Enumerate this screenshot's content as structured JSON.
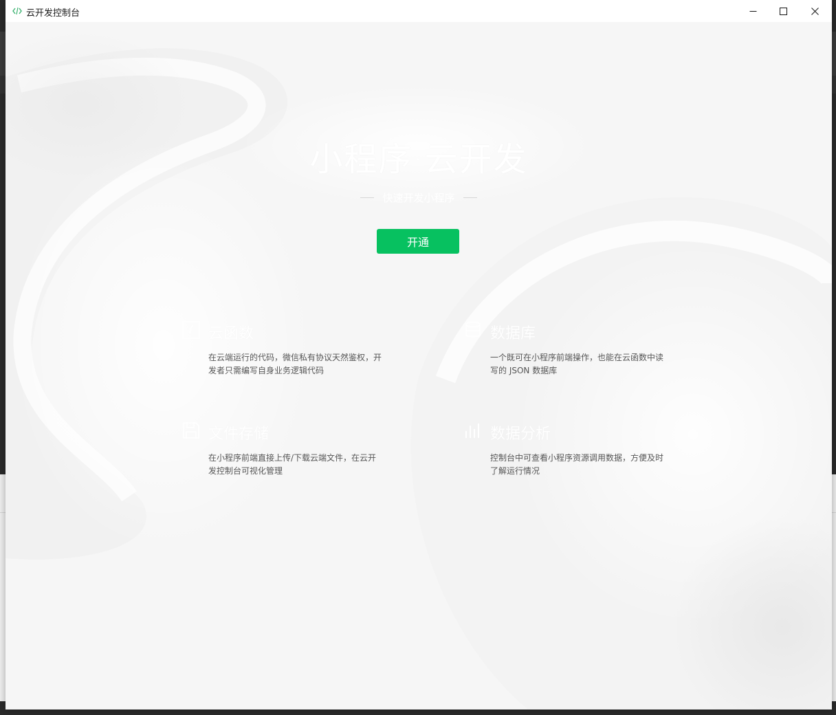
{
  "window": {
    "title": "云开发控制台",
    "controls": {
      "minimize_icon": "minimize-icon",
      "maximize_icon": "maximize-icon",
      "close_icon": "close-icon"
    }
  },
  "hero": {
    "title": "小程序·云开发",
    "subtitle": "快速开发小程序",
    "cta_label": "开通"
  },
  "features": [
    {
      "icon": "function-icon",
      "title": "云函数",
      "description": "在云端运行的代码，微信私有协议天然鉴权，开发者只需编写自身业务逻辑代码"
    },
    {
      "icon": "database-icon",
      "title": "数据库",
      "description": "一个既可在小程序前端操作，也能在云函数中读写的 JSON 数据库"
    },
    {
      "icon": "storage-icon",
      "title": "文件存储",
      "description": "在小程序前端直接上传/下载云端文件，在云开发控制台可视化管理"
    },
    {
      "icon": "analytics-icon",
      "title": "数据分析",
      "description": "控制台中可查看小程序资源调用数据，方便及时了解运行情况"
    }
  ],
  "colors": {
    "accent": "#07c160",
    "background": "#f7f7f7",
    "icon_green": "#3cb371"
  }
}
